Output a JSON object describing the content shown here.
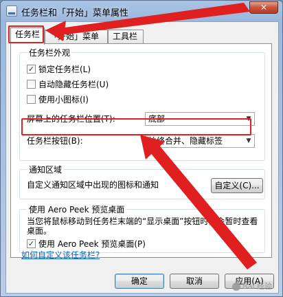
{
  "window": {
    "title": "任务栏和「开始」菜单属性",
    "close_glyph": "✕"
  },
  "tabs": [
    {
      "label": "任务栏",
      "active": true
    },
    {
      "label": "「开始」菜单",
      "active": false
    },
    {
      "label": "工具栏",
      "active": false
    }
  ],
  "appearance": {
    "title": "任务栏外观",
    "lock_label": "锁定任务栏(L)",
    "lock_checked": true,
    "autohide_label": "自动隐藏任务栏(U)",
    "autohide_checked": false,
    "small_icons_label": "使用小图标(I)",
    "small_icons_checked": false,
    "location_label": "屏幕上的任务栏位置(T):",
    "location_value": "底部",
    "buttons_label": "任务栏按钮(B):",
    "buttons_value": "始终合并、隐藏标签"
  },
  "notification": {
    "title": "通知区域",
    "description": "自定义通知区域中出现的图标和通知",
    "customize_button": "自定义(C)..."
  },
  "peek": {
    "title": "使用 Aero Peek 预览桌面",
    "description": "当您将鼠标移动到任务栏末端的“显示桌面”按钮时，会暂时查看桌面。",
    "checkbox_label": "使用 Aero Peek 预览桌面(P)",
    "checkbox_checked": true
  },
  "help_link": "如何自定义该任务栏?",
  "buttons": {
    "ok": "确定",
    "cancel": "取消",
    "apply": "应用(A)"
  },
  "annotation": {
    "color": "#e02020"
  },
  "watermark": "Bai 经验"
}
